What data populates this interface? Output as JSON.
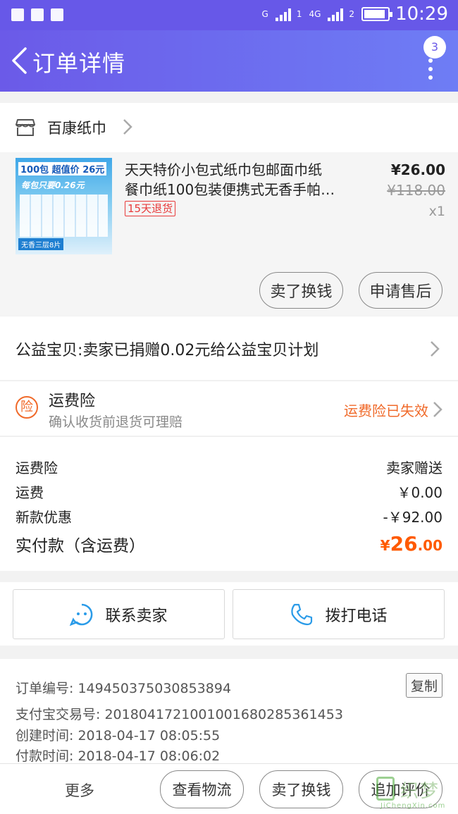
{
  "status_bar": {
    "network_1": "G",
    "network_2": "4G",
    "sim_1": "1",
    "sim_2": "2",
    "battery_level": 0.9,
    "time": "10:29"
  },
  "header": {
    "title": "订单详情",
    "badge_count": "3"
  },
  "shop": {
    "name": "百康纸巾"
  },
  "product": {
    "image_text": {
      "headline": "100包 超值价 26元",
      "sub": "每包只要0.26元",
      "footer": "无香三层8片"
    },
    "title_line1": "天天特价小包式纸巾包邮面巾纸",
    "title_line2": "餐巾纸100包装便携式无香手帕…",
    "refund_tag": "15天退货",
    "price": "¥26.00",
    "original_price": "¥118.00",
    "quantity": "x1",
    "sell_button": "卖了换钱",
    "aftersale_button": "申请售后"
  },
  "charity": {
    "text": "公益宝贝:卖家已捐赠0.02元给公益宝贝计划"
  },
  "insurance": {
    "icon_char": "险",
    "title": "运费险",
    "subtitle": "确认收货前退货可理赔",
    "status": "运费险已失效"
  },
  "fees": [
    {
      "label": "运费险",
      "value": "卖家赠送"
    },
    {
      "label": "运费",
      "value": "￥0.00"
    },
    {
      "label": "新款优惠",
      "value": "-￥92.00"
    }
  ],
  "total": {
    "label": "实付款（含运费）",
    "currency": "¥",
    "integer": "26",
    "decimal": ".00"
  },
  "contact": {
    "seller_label": "联系卖家",
    "call_label": "拨打电话"
  },
  "order_meta": {
    "order_no": "订单编号: 149450375030853894",
    "alipay_no": "支付宝交易号: 2018041721001001680285361453",
    "created": "创建时间: 2018-04-17 08:05:55",
    "paid": "付款时间: 2018-04-17 08:06:02",
    "copy_label": "复制"
  },
  "bottom_bar": {
    "more": "更多",
    "logistics": "查看物流",
    "sell": "卖了换钱",
    "review": "追加评价"
  },
  "watermark": {
    "text": "织梦",
    "url": "JiChengXin.com"
  },
  "colors": {
    "header_start": "#6b5ae8",
    "header_end": "#6e7df5",
    "accent_orange": "#ff5a00",
    "insurance_orange": "#f06a2a",
    "refund_red": "#e83a3a"
  }
}
